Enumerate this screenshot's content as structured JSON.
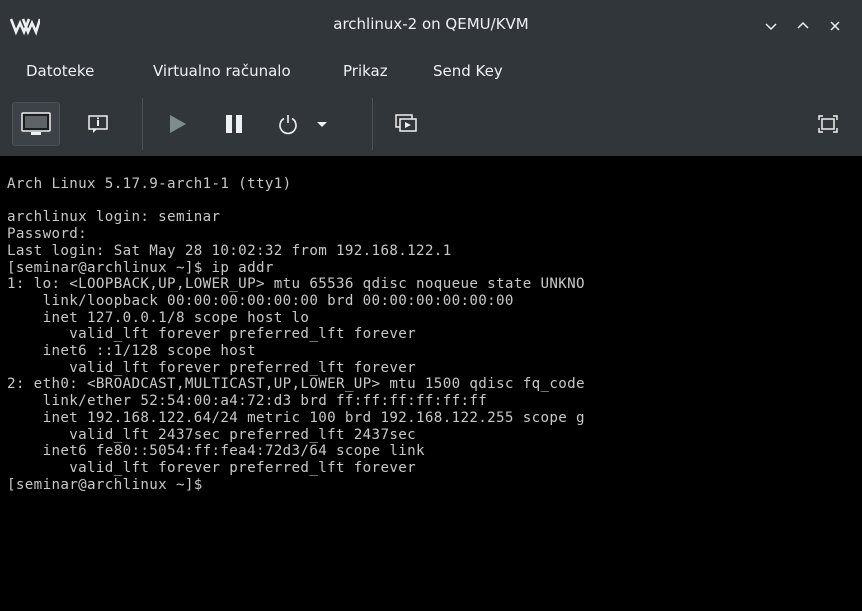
{
  "window": {
    "title": "archlinux-2 on QEMU/KVM",
    "controls": [
      "minimize",
      "maximize",
      "close"
    ]
  },
  "menu": {
    "items": [
      "Datoteke",
      "Virtualno računalo",
      "Prikaz",
      "Send Key"
    ]
  },
  "toolbar": {
    "buttons": [
      {
        "name": "console-view",
        "icon": "monitor-icon",
        "active": true
      },
      {
        "name": "details-view",
        "icon": "info-icon"
      },
      {
        "name": "run",
        "icon": "play-icon"
      },
      {
        "name": "pause",
        "icon": "pause-icon"
      },
      {
        "name": "shutdown",
        "icon": "power-icon"
      },
      {
        "name": "shutdown-menu",
        "icon": "chevron-down-icon"
      },
      {
        "name": "snapshots",
        "icon": "snapshot-icon"
      },
      {
        "name": "fullscreen",
        "icon": "fullscreen-icon"
      }
    ]
  },
  "console": {
    "lines": [
      "Arch Linux 5.17.9-arch1-1 (tty1)",
      "",
      "archlinux login: seminar",
      "Password:",
      "Last login: Sat May 28 10:02:32 from 192.168.122.1",
      "[seminar@archlinux ~]$ ip addr",
      "1: lo: <LOOPBACK,UP,LOWER_UP> mtu 65536 qdisc noqueue state UNKNO",
      "    link/loopback 00:00:00:00:00:00 brd 00:00:00:00:00:00",
      "    inet 127.0.0.1/8 scope host lo",
      "       valid_lft forever preferred_lft forever",
      "    inet6 ::1/128 scope host",
      "       valid_lft forever preferred_lft forever",
      "2: eth0: <BROADCAST,MULTICAST,UP,LOWER_UP> mtu 1500 qdisc fq_code",
      "    link/ether 52:54:00:a4:72:d3 brd ff:ff:ff:ff:ff:ff",
      "    inet 192.168.122.64/24 metric 100 brd 192.168.122.255 scope g",
      "       valid_lft 2437sec preferred_lft 2437sec",
      "    inet6 fe80::5054:ff:fea4:72d3/64 scope link",
      "       valid_lft forever preferred_lft forever",
      "[seminar@archlinux ~]$"
    ]
  },
  "colors": {
    "chrome_bg": "#31363b",
    "chrome_text": "#eff0f1",
    "console_bg": "#000000",
    "console_text": "#c8c8c8"
  }
}
